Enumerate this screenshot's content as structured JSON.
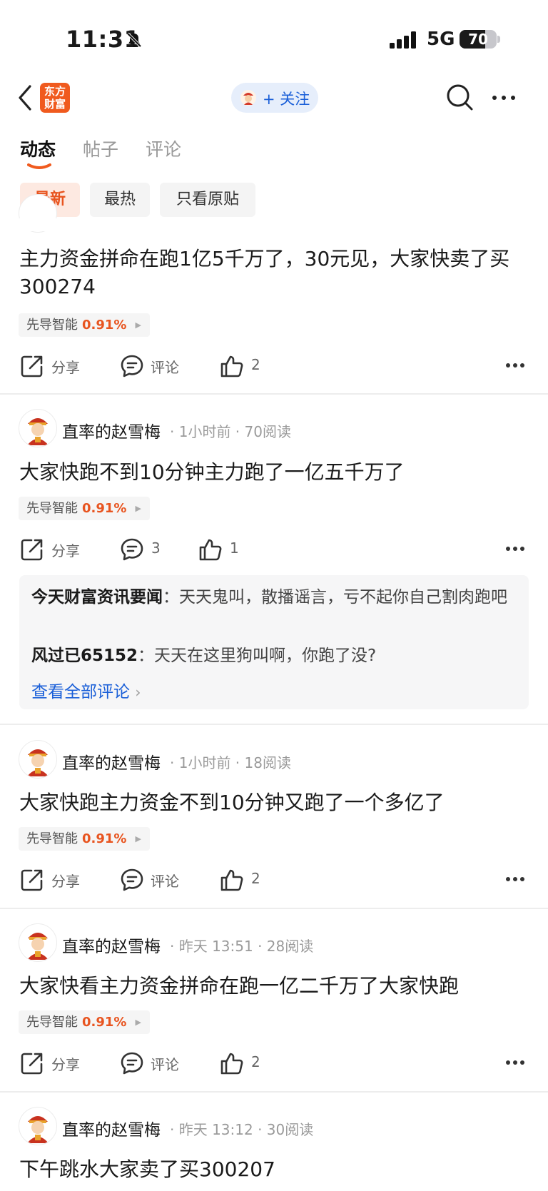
{
  "status_bar": {
    "time": "11:31",
    "network": "5G",
    "battery": "70",
    "battery_level": 0.7
  },
  "nav": {
    "logo_text_1": "东方",
    "logo_text_2": "财富",
    "follow_label": "+ 关注"
  },
  "tabs": [
    {
      "label": "动态"
    },
    {
      "label": "帖子"
    },
    {
      "label": "评论"
    }
  ],
  "filters": [
    {
      "label": "最新"
    },
    {
      "label": "最热"
    },
    {
      "label": "只看原贴"
    }
  ],
  "posts": [
    {
      "text": "主力资金拼命在跑1亿5千万了，30元见，大家快卖了买300274",
      "stock": {
        "name": "先导智能",
        "change": "0.91%"
      },
      "actions": {
        "share": "分享",
        "comment": "评论",
        "likes": "2"
      }
    },
    {
      "author": "直率的赵雪梅",
      "time": "1小时前",
      "reads": "70阅读",
      "text": "大家快跑不到10分钟主力跑了一亿五千万了",
      "stock": {
        "name": "先导智能",
        "change": "0.91%"
      },
      "actions": {
        "share": "分享",
        "comment": "3",
        "likes": "1"
      },
      "comments": [
        {
          "user": "今天财富资讯要闻",
          "text": "天天鬼叫，散播谣言，亏不起你自己割肉跑吧"
        },
        {
          "user": "风过已65152",
          "text": "天天在这里狗叫啊，你跑了没?"
        }
      ],
      "view_all": "查看全部评论"
    },
    {
      "author": "直率的赵雪梅",
      "time": "1小时前",
      "reads": "18阅读",
      "text": "大家快跑主力资金不到10分钟又跑了一个多亿了",
      "stock": {
        "name": "先导智能",
        "change": "0.91%"
      },
      "actions": {
        "share": "分享",
        "comment": "评论",
        "likes": "2"
      }
    },
    {
      "author": "直率的赵雪梅",
      "time": "昨天 13:51",
      "reads": "28阅读",
      "text": "大家快看主力资金拼命在跑一亿二千万了大家快跑",
      "stock": {
        "name": "先导智能",
        "change": "0.91%"
      },
      "actions": {
        "share": "分享",
        "comment": "评论",
        "likes": "2"
      }
    },
    {
      "author": "直率的赵雪梅",
      "time": "昨天 13:12",
      "reads": "30阅读",
      "text": "下午跳水大家卖了买300207"
    }
  ],
  "colors": {
    "accent": "#e8541f",
    "link": "#1a5fd8",
    "brand": "#f05a1e"
  },
  "icons": [
    "back-icon",
    "search-icon",
    "more-icon",
    "share-icon",
    "comment-icon",
    "like-icon",
    "bell-muted-icon",
    "signal-icon"
  ]
}
